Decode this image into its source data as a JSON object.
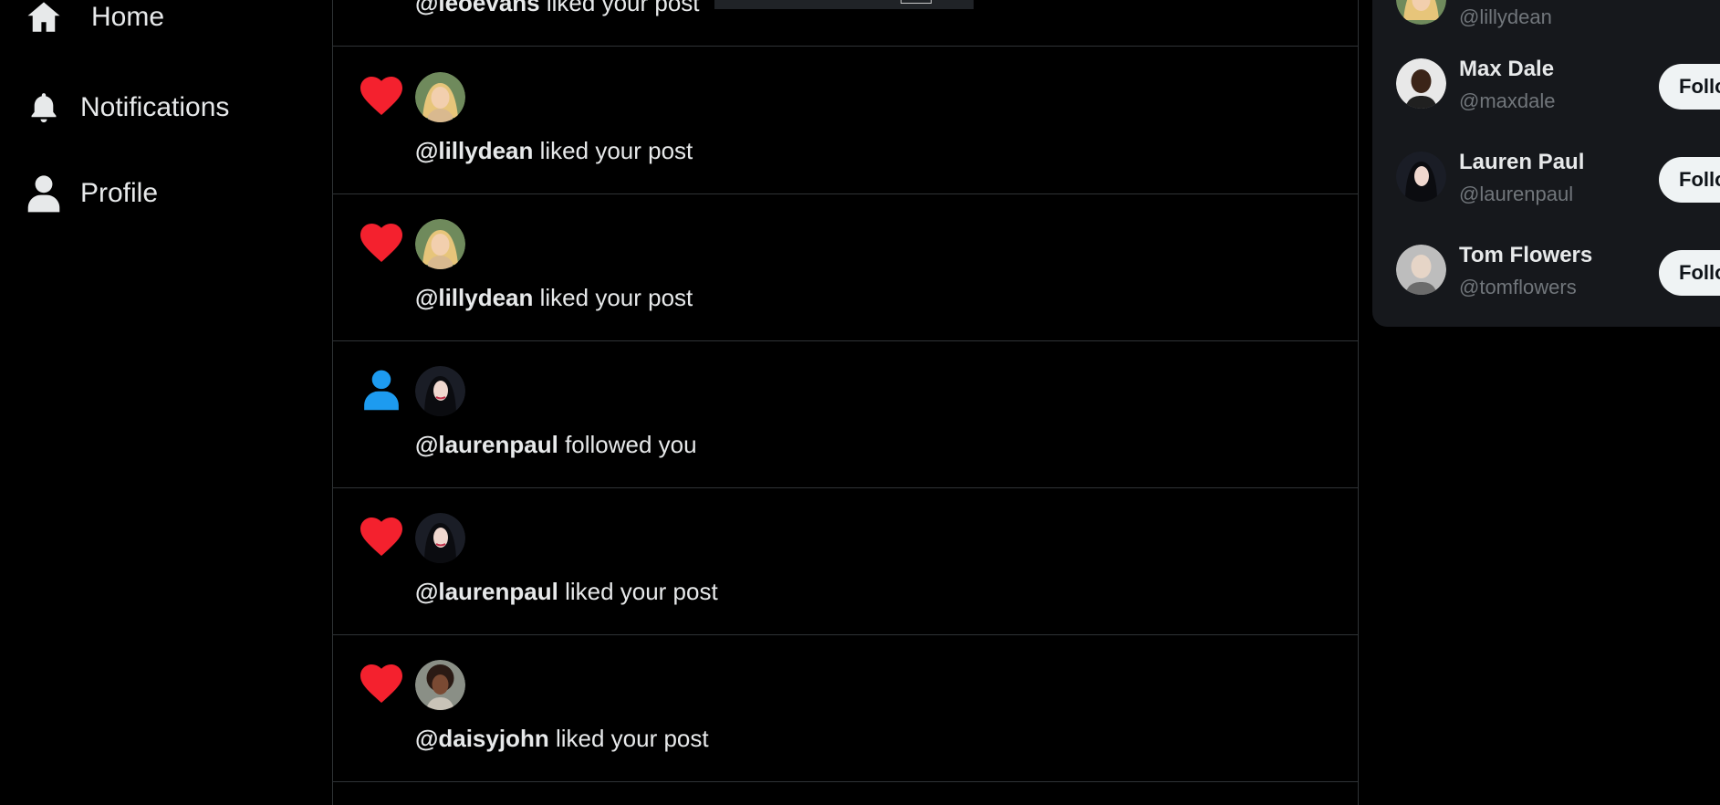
{
  "nav": {
    "items": [
      {
        "label": "Home",
        "icon": "home-icon"
      },
      {
        "label": "Notifications",
        "icon": "bell-icon"
      },
      {
        "label": "Profile",
        "icon": "user-icon"
      }
    ]
  },
  "feed": {
    "top_partial": {
      "handle": "@leoevans",
      "text": "liked your post"
    },
    "notifications": [
      {
        "type": "like",
        "icon": "heart-icon",
        "handle": "@lillydean",
        "text": "liked your post"
      },
      {
        "type": "like",
        "icon": "heart-icon",
        "handle": "@lillydean",
        "text": "liked your post"
      },
      {
        "type": "follow",
        "icon": "user-icon",
        "handle": "@laurenpaul",
        "text": "followed you"
      },
      {
        "type": "like",
        "icon": "heart-icon",
        "handle": "@laurenpaul",
        "text": "liked your post"
      },
      {
        "type": "like",
        "icon": "heart-icon",
        "handle": "@daisyjohn",
        "text": "liked your post"
      }
    ]
  },
  "who_to_follow": {
    "partial": {
      "handle": "@lillydean"
    },
    "users": [
      {
        "name": "Max Dale",
        "handle": "@maxdale",
        "button": "Follow"
      },
      {
        "name": "Lauren Paul",
        "handle": "@laurenpaul",
        "button": "Follow"
      },
      {
        "name": "Tom Flowers",
        "handle": "@tomflowers",
        "button": "Follow"
      }
    ]
  },
  "colors": {
    "background": "#000000",
    "panel": "#16181c",
    "border": "#2f3336",
    "like_red": "#f4212e",
    "follow_blue": "#1d9bf0",
    "muted_text": "#71767b"
  }
}
